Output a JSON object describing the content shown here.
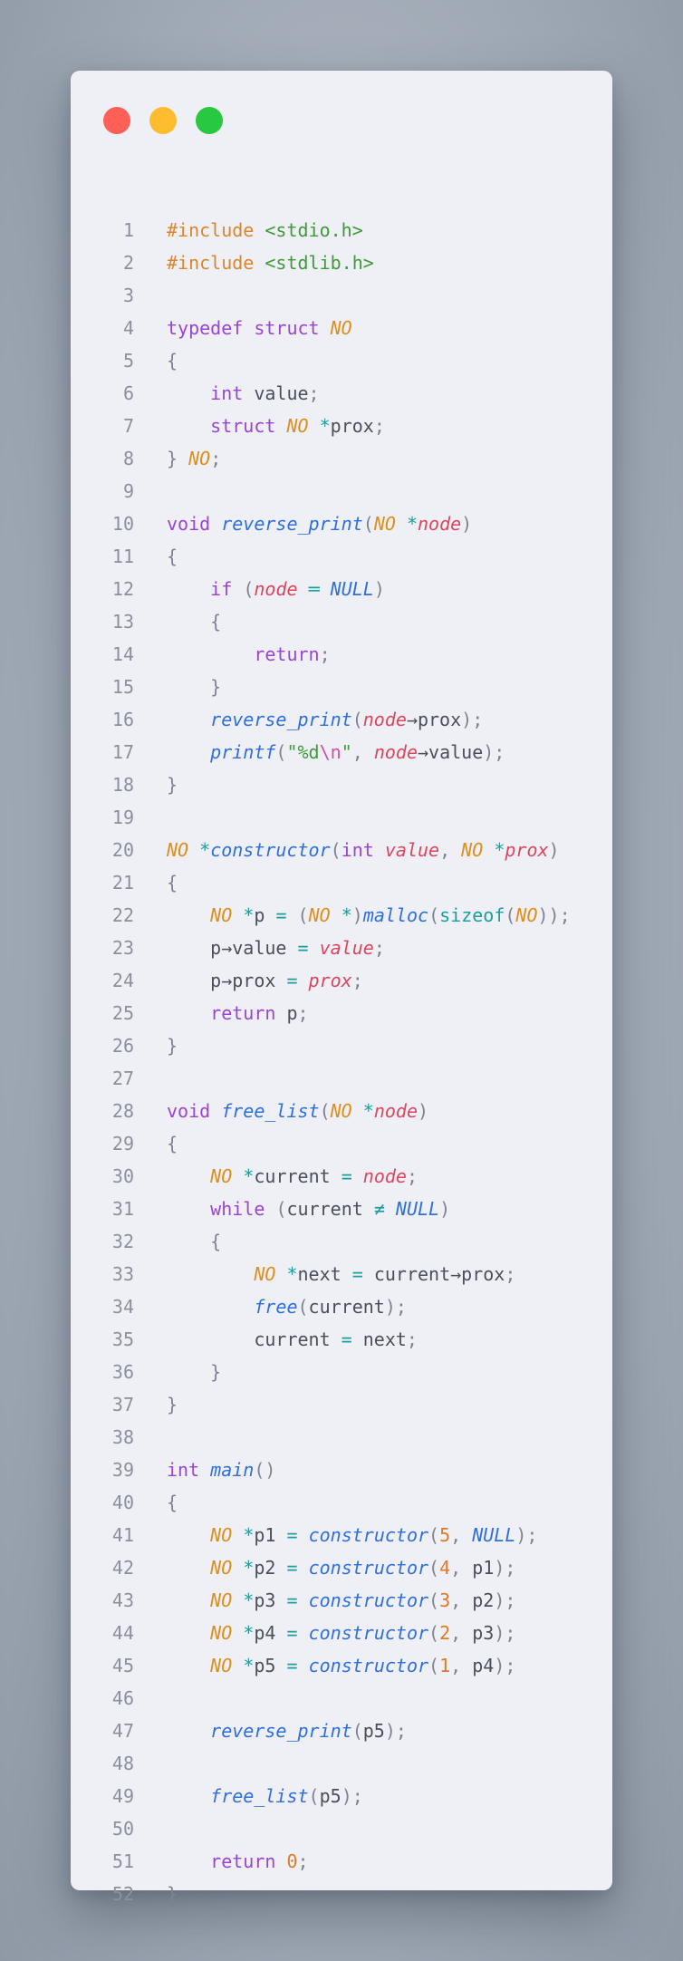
{
  "window": {
    "controls": [
      {
        "name": "close",
        "color": "#fe5f57"
      },
      {
        "name": "minimize",
        "color": "#febc2e"
      },
      {
        "name": "maximize",
        "color": "#28c840"
      }
    ]
  },
  "code": {
    "language": "c",
    "lines": [
      [
        [
          "pre",
          "#include "
        ],
        [
          "str",
          "<stdio.h>"
        ]
      ],
      [
        [
          "pre",
          "#include "
        ],
        [
          "str",
          "<stdlib.h>"
        ]
      ],
      [],
      [
        [
          "kw",
          "typedef"
        ],
        [
          "text",
          " "
        ],
        [
          "kw",
          "struct"
        ],
        [
          "text",
          " "
        ],
        [
          "type",
          "NO"
        ]
      ],
      [
        [
          "punc",
          "{"
        ]
      ],
      [
        [
          "text",
          "    "
        ],
        [
          "kw",
          "int"
        ],
        [
          "text",
          " value"
        ],
        [
          "punc",
          ";"
        ]
      ],
      [
        [
          "text",
          "    "
        ],
        [
          "kw",
          "struct"
        ],
        [
          "text",
          " "
        ],
        [
          "type",
          "NO"
        ],
        [
          "text",
          " "
        ],
        [
          "op",
          "*"
        ],
        [
          "text",
          "prox"
        ],
        [
          "punc",
          ";"
        ]
      ],
      [
        [
          "punc",
          "}"
        ],
        [
          "text",
          " "
        ],
        [
          "type",
          "NO"
        ],
        [
          "punc",
          ";"
        ]
      ],
      [],
      [
        [
          "kw",
          "void"
        ],
        [
          "text",
          " "
        ],
        [
          "fn",
          "reverse_print"
        ],
        [
          "punc",
          "("
        ],
        [
          "type",
          "NO"
        ],
        [
          "text",
          " "
        ],
        [
          "op",
          "*"
        ],
        [
          "param",
          "node"
        ],
        [
          "punc",
          ")"
        ]
      ],
      [
        [
          "punc",
          "{"
        ]
      ],
      [
        [
          "text",
          "    "
        ],
        [
          "kw",
          "if"
        ],
        [
          "text",
          " "
        ],
        [
          "punc",
          "("
        ],
        [
          "param",
          "node"
        ],
        [
          "text",
          " "
        ],
        [
          "op",
          "=="
        ],
        [
          "text",
          " "
        ],
        [
          "const",
          "NULL"
        ],
        [
          "punc",
          ")"
        ]
      ],
      [
        [
          "text",
          "    "
        ],
        [
          "punc",
          "{"
        ]
      ],
      [
        [
          "text",
          "        "
        ],
        [
          "kw",
          "return"
        ],
        [
          "punc",
          ";"
        ]
      ],
      [
        [
          "text",
          "    "
        ],
        [
          "punc",
          "}"
        ]
      ],
      [
        [
          "text",
          "    "
        ],
        [
          "fn",
          "reverse_print"
        ],
        [
          "punc",
          "("
        ],
        [
          "param",
          "node"
        ],
        [
          "text",
          "->prox"
        ],
        [
          "punc",
          ");"
        ]
      ],
      [
        [
          "text",
          "    "
        ],
        [
          "fn",
          "printf"
        ],
        [
          "punc",
          "("
        ],
        [
          "str",
          "\"%d"
        ],
        [
          "esc",
          "\\n"
        ],
        [
          "str",
          "\""
        ],
        [
          "punc",
          ", "
        ],
        [
          "param",
          "node"
        ],
        [
          "text",
          "->value"
        ],
        [
          "punc",
          ");"
        ]
      ],
      [
        [
          "punc",
          "}"
        ]
      ],
      [],
      [
        [
          "type",
          "NO"
        ],
        [
          "text",
          " "
        ],
        [
          "op",
          "*"
        ],
        [
          "fn",
          "constructor"
        ],
        [
          "punc",
          "("
        ],
        [
          "kw",
          "int"
        ],
        [
          "text",
          " "
        ],
        [
          "param",
          "value"
        ],
        [
          "punc",
          ", "
        ],
        [
          "type",
          "NO"
        ],
        [
          "text",
          " "
        ],
        [
          "op",
          "*"
        ],
        [
          "param",
          "prox"
        ],
        [
          "punc",
          ")"
        ]
      ],
      [
        [
          "punc",
          "{"
        ]
      ],
      [
        [
          "text",
          "    "
        ],
        [
          "type",
          "NO"
        ],
        [
          "text",
          " "
        ],
        [
          "op",
          "*"
        ],
        [
          "text",
          "p "
        ],
        [
          "op",
          "="
        ],
        [
          "text",
          " "
        ],
        [
          "punc",
          "("
        ],
        [
          "type",
          "NO"
        ],
        [
          "text",
          " "
        ],
        [
          "op",
          "*"
        ],
        [
          "punc",
          ")"
        ],
        [
          "fn",
          "malloc"
        ],
        [
          "punc",
          "("
        ],
        [
          "builtin",
          "sizeof"
        ],
        [
          "punc",
          "("
        ],
        [
          "type",
          "NO"
        ],
        [
          "punc",
          "));"
        ]
      ],
      [
        [
          "text",
          "    p->value "
        ],
        [
          "op",
          "="
        ],
        [
          "text",
          " "
        ],
        [
          "param",
          "value"
        ],
        [
          "punc",
          ";"
        ]
      ],
      [
        [
          "text",
          "    p->prox "
        ],
        [
          "op",
          "="
        ],
        [
          "text",
          " "
        ],
        [
          "param",
          "prox"
        ],
        [
          "punc",
          ";"
        ]
      ],
      [
        [
          "text",
          "    "
        ],
        [
          "kw",
          "return"
        ],
        [
          "text",
          " p"
        ],
        [
          "punc",
          ";"
        ]
      ],
      [
        [
          "punc",
          "}"
        ]
      ],
      [],
      [
        [
          "kw",
          "void"
        ],
        [
          "text",
          " "
        ],
        [
          "fn",
          "free_list"
        ],
        [
          "punc",
          "("
        ],
        [
          "type",
          "NO"
        ],
        [
          "text",
          " "
        ],
        [
          "op",
          "*"
        ],
        [
          "param",
          "node"
        ],
        [
          "punc",
          ")"
        ]
      ],
      [
        [
          "punc",
          "{"
        ]
      ],
      [
        [
          "text",
          "    "
        ],
        [
          "type",
          "NO"
        ],
        [
          "text",
          " "
        ],
        [
          "op",
          "*"
        ],
        [
          "text",
          "current "
        ],
        [
          "op",
          "="
        ],
        [
          "text",
          " "
        ],
        [
          "param",
          "node"
        ],
        [
          "punc",
          ";"
        ]
      ],
      [
        [
          "text",
          "    "
        ],
        [
          "kw",
          "while"
        ],
        [
          "text",
          " "
        ],
        [
          "punc",
          "("
        ],
        [
          "text",
          "current "
        ],
        [
          "op",
          "!="
        ],
        [
          "text",
          " "
        ],
        [
          "const",
          "NULL"
        ],
        [
          "punc",
          ")"
        ]
      ],
      [
        [
          "text",
          "    "
        ],
        [
          "punc",
          "{"
        ]
      ],
      [
        [
          "text",
          "        "
        ],
        [
          "type",
          "NO"
        ],
        [
          "text",
          " "
        ],
        [
          "op",
          "*"
        ],
        [
          "text",
          "next "
        ],
        [
          "op",
          "="
        ],
        [
          "text",
          " current->prox"
        ],
        [
          "punc",
          ";"
        ]
      ],
      [
        [
          "text",
          "        "
        ],
        [
          "fn",
          "free"
        ],
        [
          "punc",
          "("
        ],
        [
          "text",
          "current"
        ],
        [
          "punc",
          ");"
        ]
      ],
      [
        [
          "text",
          "        current "
        ],
        [
          "op",
          "="
        ],
        [
          "text",
          " next"
        ],
        [
          "punc",
          ";"
        ]
      ],
      [
        [
          "text",
          "    "
        ],
        [
          "punc",
          "}"
        ]
      ],
      [
        [
          "punc",
          "}"
        ]
      ],
      [],
      [
        [
          "kw",
          "int"
        ],
        [
          "text",
          " "
        ],
        [
          "fn",
          "main"
        ],
        [
          "punc",
          "()"
        ]
      ],
      [
        [
          "punc",
          "{"
        ]
      ],
      [
        [
          "text",
          "    "
        ],
        [
          "type",
          "NO"
        ],
        [
          "text",
          " "
        ],
        [
          "op",
          "*"
        ],
        [
          "text",
          "p1 "
        ],
        [
          "op",
          "="
        ],
        [
          "text",
          " "
        ],
        [
          "fn",
          "constructor"
        ],
        [
          "punc",
          "("
        ],
        [
          "num",
          "5"
        ],
        [
          "punc",
          ", "
        ],
        [
          "const",
          "NULL"
        ],
        [
          "punc",
          ");"
        ]
      ],
      [
        [
          "text",
          "    "
        ],
        [
          "type",
          "NO"
        ],
        [
          "text",
          " "
        ],
        [
          "op",
          "*"
        ],
        [
          "text",
          "p2 "
        ],
        [
          "op",
          "="
        ],
        [
          "text",
          " "
        ],
        [
          "fn",
          "constructor"
        ],
        [
          "punc",
          "("
        ],
        [
          "num",
          "4"
        ],
        [
          "punc",
          ", "
        ],
        [
          "text",
          "p1"
        ],
        [
          "punc",
          ");"
        ]
      ],
      [
        [
          "text",
          "    "
        ],
        [
          "type",
          "NO"
        ],
        [
          "text",
          " "
        ],
        [
          "op",
          "*"
        ],
        [
          "text",
          "p3 "
        ],
        [
          "op",
          "="
        ],
        [
          "text",
          " "
        ],
        [
          "fn",
          "constructor"
        ],
        [
          "punc",
          "("
        ],
        [
          "num",
          "3"
        ],
        [
          "punc",
          ", "
        ],
        [
          "text",
          "p2"
        ],
        [
          "punc",
          ");"
        ]
      ],
      [
        [
          "text",
          "    "
        ],
        [
          "type",
          "NO"
        ],
        [
          "text",
          " "
        ],
        [
          "op",
          "*"
        ],
        [
          "text",
          "p4 "
        ],
        [
          "op",
          "="
        ],
        [
          "text",
          " "
        ],
        [
          "fn",
          "constructor"
        ],
        [
          "punc",
          "("
        ],
        [
          "num",
          "2"
        ],
        [
          "punc",
          ", "
        ],
        [
          "text",
          "p3"
        ],
        [
          "punc",
          ");"
        ]
      ],
      [
        [
          "text",
          "    "
        ],
        [
          "type",
          "NO"
        ],
        [
          "text",
          " "
        ],
        [
          "op",
          "*"
        ],
        [
          "text",
          "p5 "
        ],
        [
          "op",
          "="
        ],
        [
          "text",
          " "
        ],
        [
          "fn",
          "constructor"
        ],
        [
          "punc",
          "("
        ],
        [
          "num",
          "1"
        ],
        [
          "punc",
          ", "
        ],
        [
          "text",
          "p4"
        ],
        [
          "punc",
          ");"
        ]
      ],
      [],
      [
        [
          "text",
          "    "
        ],
        [
          "fn",
          "reverse_print"
        ],
        [
          "punc",
          "("
        ],
        [
          "text",
          "p5"
        ],
        [
          "punc",
          ");"
        ]
      ],
      [],
      [
        [
          "text",
          "    "
        ],
        [
          "fn",
          "free_list"
        ],
        [
          "punc",
          "("
        ],
        [
          "text",
          "p5"
        ],
        [
          "punc",
          ");"
        ]
      ],
      [],
      [
        [
          "text",
          "    "
        ],
        [
          "kw",
          "return"
        ],
        [
          "text",
          " "
        ],
        [
          "num",
          "0"
        ],
        [
          "punc",
          ";"
        ]
      ],
      [
        [
          "punc",
          "}"
        ]
      ]
    ]
  }
}
